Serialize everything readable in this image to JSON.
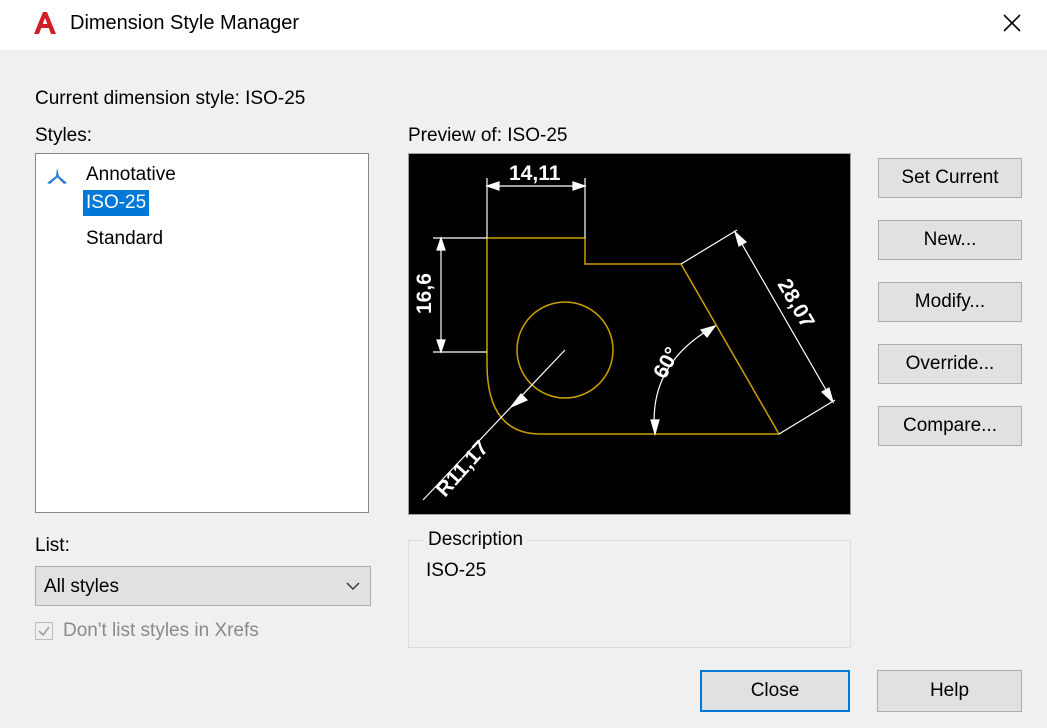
{
  "window": {
    "title": "Dimension Style Manager",
    "close_icon": "close-icon",
    "app_icon": "autocad-logo-icon"
  },
  "current_style": {
    "label": "Current dimension style: ISO-25"
  },
  "styles": {
    "label": "Styles:",
    "items": [
      {
        "label": "Annotative",
        "icon": "annotative-icon",
        "selected": false
      },
      {
        "label": "ISO-25",
        "selected": true
      },
      {
        "label": "Standard",
        "selected": false
      }
    ]
  },
  "preview": {
    "label": "Preview of: ISO-25",
    "dims": {
      "top_width": "14,11",
      "left_height": "16,6",
      "angled": "28,07",
      "angle": "60°",
      "radius": "R11,17"
    },
    "colors": {
      "background": "#000000",
      "geometry": "#c8a000",
      "dimensions": "#ffffff"
    }
  },
  "list": {
    "label": "List:",
    "selected": "All styles",
    "checkbox_label": "Don't list styles in Xrefs",
    "checkbox_checked": true,
    "checkbox_disabled": true
  },
  "description": {
    "legend": "Description",
    "text": "ISO-25"
  },
  "buttons": {
    "set_current": "Set Current",
    "new": "New...",
    "modify": "Modify...",
    "override": "Override...",
    "compare": "Compare...",
    "close": "Close",
    "help": "Help"
  },
  "accent_color": "#0078d7"
}
